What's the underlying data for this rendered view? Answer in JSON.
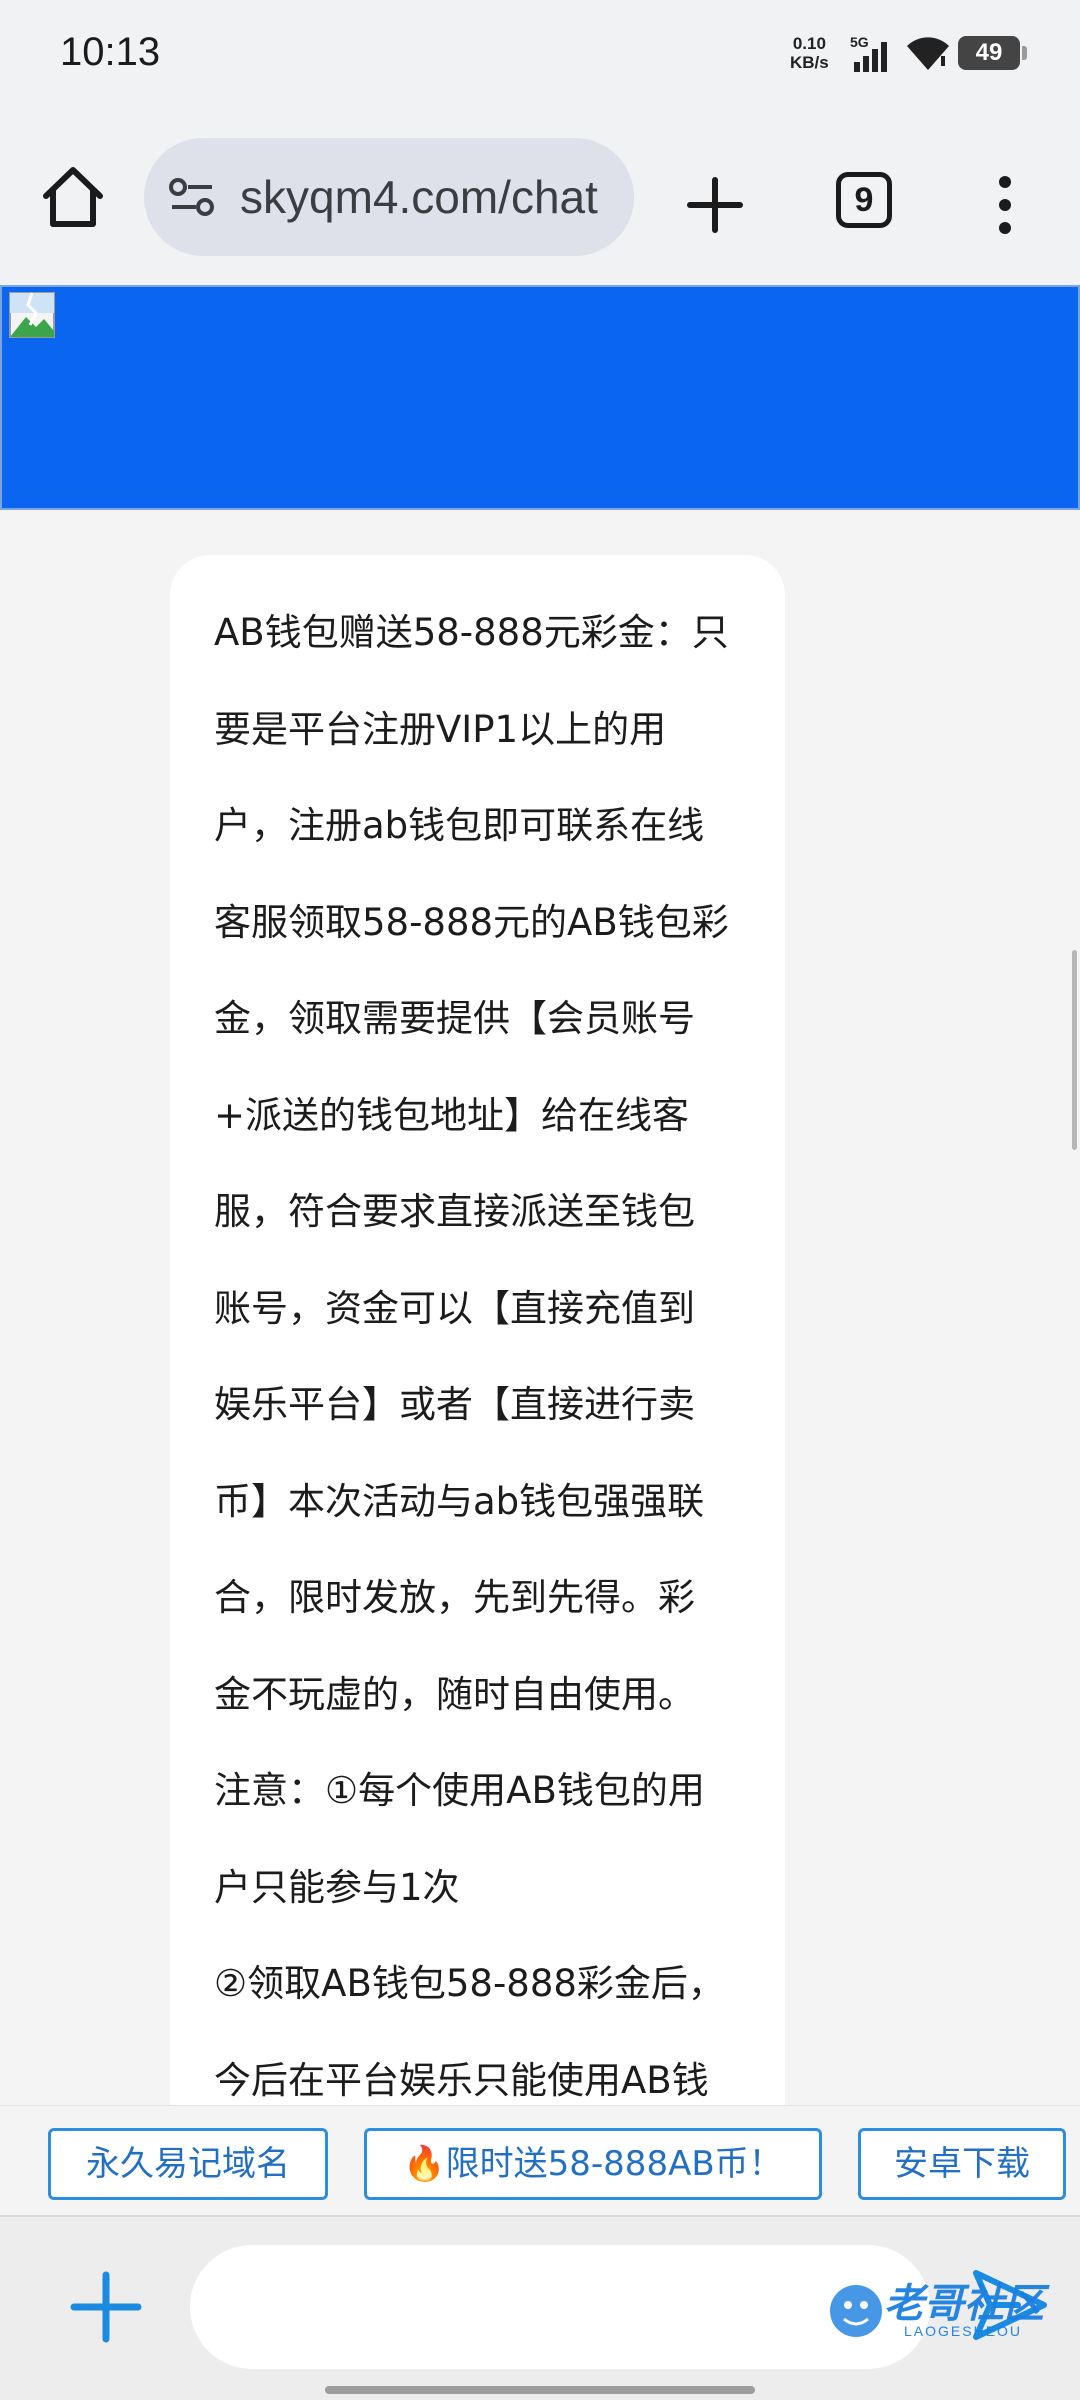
{
  "status_bar": {
    "time": "10:13",
    "net_speed_value": "0.10",
    "net_speed_unit": "KB/s",
    "network": "5G",
    "battery": "49"
  },
  "browser": {
    "url": "skyqm4.com/chat",
    "tab_count": "9",
    "icons": [
      "home-icon",
      "site-settings-icon",
      "new-tab-icon",
      "tab-switcher-icon",
      "more-menu-icon"
    ]
  },
  "banner": {
    "color": "#0a66f1",
    "image": "broken-image-icon"
  },
  "chat": {
    "lines": [
      "AB钱包赠送58-888元彩金：只",
      "要是平台注册VIP1以上的用",
      "户，注册ab钱包即可联系在线",
      "客服领取58-888元的AB钱包彩",
      "金，领取需要提供【会员账号",
      "+派送的钱包地址】给在线客",
      "服，符合要求直接派送至钱包",
      "账号，资金可以【直接充值到",
      "娱乐平台】或者【直接进行卖",
      "币】本次活动与ab钱包强强联",
      "合，限时发放，先到先得。彩",
      "金不玩虚的，随时自由使用。",
      "注意：①每个使用AB钱包的用",
      "户只能参与1次",
      "②领取AB钱包58-888彩金后，",
      "今后在平台娱乐只能使用AB钱"
    ]
  },
  "quick_links": [
    "永久易记域名",
    "🔥限时送58-888AB币！",
    "安卓下载"
  ],
  "input": {
    "value": "",
    "placeholder": ""
  },
  "watermark": {
    "text": "老哥社区",
    "sub": "LAOGESHEOU"
  },
  "colors": {
    "accent": "#2d8edb",
    "link_text": "#2370c3",
    "banner": "#0a66f1"
  }
}
